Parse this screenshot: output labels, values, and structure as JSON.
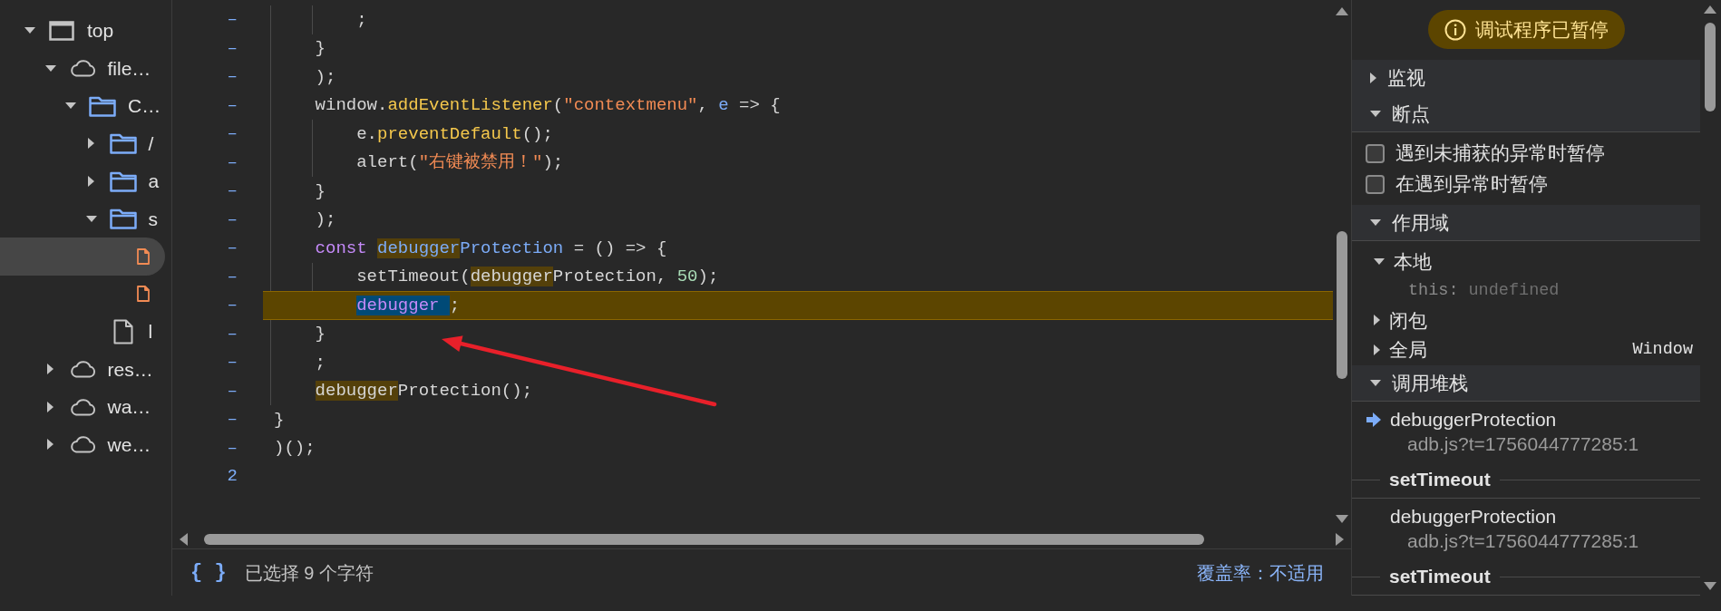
{
  "tree": [
    {
      "label": "top",
      "kind": "frame",
      "expanded": true,
      "selected": false,
      "children": [
        {
          "label": "file…",
          "kind": "cloud",
          "expanded": true,
          "selected": false,
          "children": [
            {
              "label": "C…",
              "kind": "folder",
              "expanded": true,
              "selected": false,
              "children": [
                {
                  "label": "/",
                  "kind": "folder",
                  "expanded": false,
                  "selected": false
                },
                {
                  "label": "a",
                  "kind": "folder",
                  "expanded": false,
                  "selected": false
                },
                {
                  "label": "s",
                  "kind": "folder",
                  "expanded": true,
                  "selected": false,
                  "children": [
                    {
                      "kind": "script",
                      "selected": true
                    },
                    {
                      "kind": "script",
                      "selected": false
                    }
                  ]
                },
                {
                  "label": "l",
                  "kind": "file",
                  "selected": false
                }
              ]
            }
          ]
        },
        {
          "label": "res…",
          "kind": "cloud",
          "expanded": false,
          "selected": false
        },
        {
          "label": "wa…",
          "kind": "cloud",
          "expanded": false,
          "selected": false
        },
        {
          "label": "we…",
          "kind": "cloud",
          "expanded": false,
          "selected": false
        }
      ]
    }
  ],
  "code_lines": [
    {
      "gutter": "–",
      "paused": false,
      "tokens": [
        {
          "text": "        ;",
          "kind": "plain"
        }
      ]
    },
    {
      "gutter": "–",
      "paused": false,
      "tokens": [
        {
          "text": "    }",
          "kind": "plain"
        }
      ]
    },
    {
      "gutter": "–",
      "paused": false,
      "tokens": [
        {
          "text": "    );",
          "kind": "plain"
        }
      ]
    },
    {
      "gutter": "–",
      "paused": false,
      "tokens": [
        {
          "text": "    window.",
          "kind": "plain"
        },
        {
          "text": "addEventListener",
          "kind": "function"
        },
        {
          "text": "(",
          "kind": "plain"
        },
        {
          "text": "\"contextmenu\"",
          "kind": "string"
        },
        {
          "text": ", ",
          "kind": "plain"
        },
        {
          "text": "e",
          "kind": "variable"
        },
        {
          "text": " => {",
          "kind": "plain"
        }
      ]
    },
    {
      "gutter": "–",
      "paused": false,
      "tokens": [
        {
          "text": "        e.",
          "kind": "plain"
        },
        {
          "text": "preventDefault",
          "kind": "function"
        },
        {
          "text": "();",
          "kind": "plain"
        }
      ]
    },
    {
      "gutter": "–",
      "paused": false,
      "tokens": [
        {
          "text": "        alert(",
          "kind": "plain"
        },
        {
          "text": "\"右键被禁用！\"",
          "kind": "string"
        },
        {
          "text": ");",
          "kind": "plain"
        }
      ]
    },
    {
      "gutter": "–",
      "paused": false,
      "tokens": [
        {
          "text": "    }",
          "kind": "plain"
        }
      ]
    },
    {
      "gutter": "–",
      "paused": false,
      "tokens": [
        {
          "text": "    );",
          "kind": "plain"
        }
      ]
    },
    {
      "gutter": "–",
      "paused": false,
      "tokens": [
        {
          "text": "    const",
          "kind": "keyword"
        },
        {
          "text": " debugger",
          "kind": "variable",
          "search_match": true
        },
        {
          "text": "Protection",
          "kind": "variable"
        },
        {
          "text": " = () => {",
          "kind": "plain"
        }
      ]
    },
    {
      "gutter": "–",
      "paused": false,
      "tokens": [
        {
          "text": "        setTimeout(",
          "kind": "plain"
        },
        {
          "text": "debugger",
          "kind": "plain",
          "search_match": true
        },
        {
          "text": "Protection, ",
          "kind": "plain"
        },
        {
          "text": "50",
          "kind": "number"
        },
        {
          "text": ");",
          "kind": "plain"
        }
      ]
    },
    {
      "gutter": "–",
      "paused": true,
      "tokens": [
        {
          "text": "        debugger ",
          "kind": "keyword",
          "selected": true
        },
        {
          "text": ";",
          "kind": "plain"
        }
      ]
    },
    {
      "gutter": "–",
      "paused": false,
      "tokens": [
        {
          "text": "    }",
          "kind": "plain"
        }
      ]
    },
    {
      "gutter": "–",
      "paused": false,
      "tokens": [
        {
          "text": "    ;",
          "kind": "plain"
        }
      ]
    },
    {
      "gutter": "–",
      "paused": false,
      "tokens": [
        {
          "text": "    debugger",
          "kind": "plain",
          "search_match": true
        },
        {
          "text": "Protection();",
          "kind": "plain"
        }
      ]
    },
    {
      "gutter": "–",
      "paused": false,
      "tokens": [
        {
          "text": "}",
          "kind": "plain"
        }
      ]
    },
    {
      "gutter": "–",
      "paused": false,
      "tokens": [
        {
          "text": ")();",
          "kind": "plain"
        }
      ]
    },
    {
      "gutter": "2",
      "paused": false
    }
  ],
  "status_bar": {
    "format_button": "{ }",
    "selection_info": "已选择 9 个字符",
    "coverage": "覆盖率：不适用"
  },
  "debugger_panel": {
    "paused_banner": "调试程序已暂停",
    "sections": [
      {
        "kind": "watch",
        "title": "监视",
        "expanded": false
      },
      {
        "kind": "breakpoints",
        "title": "断点",
        "expanded": true,
        "options": [
          {
            "label": "遇到未捕获的异常时暂停",
            "checked": false
          },
          {
            "label": "在遇到异常时暂停",
            "checked": false
          }
        ]
      },
      {
        "kind": "scope",
        "title": "作用域",
        "expanded": true,
        "scopes": [
          {
            "label": "本地",
            "expanded": true,
            "properties": [
              {
                "name": "this:",
                "value": "undefined"
              }
            ]
          },
          {
            "label": "闭包",
            "expanded": false
          },
          {
            "label": "全局",
            "expanded": false,
            "value": "Window"
          }
        ]
      },
      {
        "kind": "call_stack",
        "title": "调用堆栈",
        "expanded": true,
        "frames": [
          {
            "kind": "frame",
            "function": "debuggerProtection",
            "location": "adb.js?t=1756044777285:1",
            "selected": true
          },
          {
            "kind": "async",
            "label": "setTimeout"
          },
          {
            "kind": "frame",
            "function": "debuggerProtection",
            "location": "adb.js?t=1756044777285:1",
            "selected": false
          },
          {
            "kind": "async",
            "label": "setTimeout"
          }
        ]
      }
    ]
  }
}
